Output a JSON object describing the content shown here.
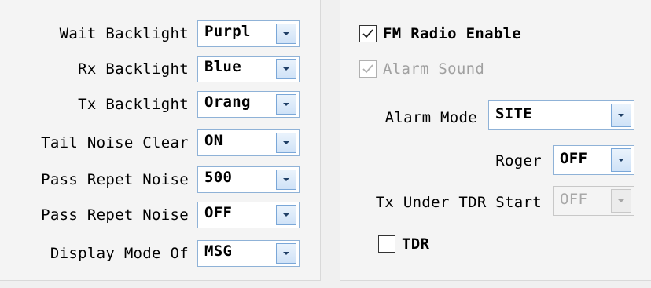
{
  "left": {
    "fields": [
      {
        "label": "Wait Backlight",
        "value": "Purpl"
      },
      {
        "label": "Rx Backlight",
        "value": "Blue"
      },
      {
        "label": "Tx Backlight",
        "value": "Orang"
      },
      {
        "label": "Tail Noise Clear",
        "value": "ON"
      },
      {
        "label": "Pass Repet Noise",
        "value": "500"
      },
      {
        "label": "Pass Repet Noise",
        "value": "OFF"
      },
      {
        "label": "Display Mode Of",
        "value": "MSG"
      }
    ]
  },
  "right": {
    "fm_radio": {
      "label": "FM Radio Enable",
      "checked": true
    },
    "alarm_sound": {
      "label": "Alarm Sound",
      "checked": true,
      "enabled": false
    },
    "alarm_mode": {
      "label": "Alarm Mode",
      "value": "SITE"
    },
    "roger": {
      "label": "Roger",
      "value": "OFF"
    },
    "tx_under_tdr": {
      "label": "Tx Under TDR Start",
      "value": "OFF",
      "enabled": false
    },
    "tdr": {
      "label": "TDR",
      "checked": false
    }
  },
  "icons": {
    "dropdown": "chevron-down-icon",
    "check": "checkmark-icon"
  },
  "colors": {
    "dropdown_button": "#cfe2f7",
    "dropdown_border": "#7aa7d8",
    "disabled_text": "#a0a0a0"
  }
}
